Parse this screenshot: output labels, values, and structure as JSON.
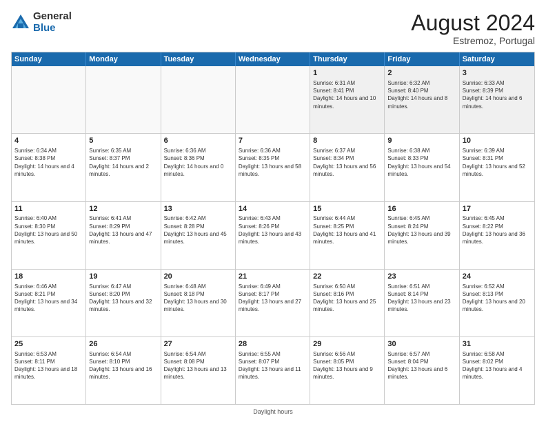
{
  "logo": {
    "general": "General",
    "blue": "Blue"
  },
  "title": {
    "month_year": "August 2024",
    "location": "Estremoz, Portugal"
  },
  "weekdays": [
    "Sunday",
    "Monday",
    "Tuesday",
    "Wednesday",
    "Thursday",
    "Friday",
    "Saturday"
  ],
  "footer": {
    "daylight_label": "Daylight hours"
  },
  "weeks": [
    [
      {
        "day": "",
        "info": ""
      },
      {
        "day": "",
        "info": ""
      },
      {
        "day": "",
        "info": ""
      },
      {
        "day": "",
        "info": ""
      },
      {
        "day": "1",
        "info": "Sunrise: 6:31 AM\nSunset: 8:41 PM\nDaylight: 14 hours and 10 minutes."
      },
      {
        "day": "2",
        "info": "Sunrise: 6:32 AM\nSunset: 8:40 PM\nDaylight: 14 hours and 8 minutes."
      },
      {
        "day": "3",
        "info": "Sunrise: 6:33 AM\nSunset: 8:39 PM\nDaylight: 14 hours and 6 minutes."
      }
    ],
    [
      {
        "day": "4",
        "info": "Sunrise: 6:34 AM\nSunset: 8:38 PM\nDaylight: 14 hours and 4 minutes."
      },
      {
        "day": "5",
        "info": "Sunrise: 6:35 AM\nSunset: 8:37 PM\nDaylight: 14 hours and 2 minutes."
      },
      {
        "day": "6",
        "info": "Sunrise: 6:36 AM\nSunset: 8:36 PM\nDaylight: 14 hours and 0 minutes."
      },
      {
        "day": "7",
        "info": "Sunrise: 6:36 AM\nSunset: 8:35 PM\nDaylight: 13 hours and 58 minutes."
      },
      {
        "day": "8",
        "info": "Sunrise: 6:37 AM\nSunset: 8:34 PM\nDaylight: 13 hours and 56 minutes."
      },
      {
        "day": "9",
        "info": "Sunrise: 6:38 AM\nSunset: 8:33 PM\nDaylight: 13 hours and 54 minutes."
      },
      {
        "day": "10",
        "info": "Sunrise: 6:39 AM\nSunset: 8:31 PM\nDaylight: 13 hours and 52 minutes."
      }
    ],
    [
      {
        "day": "11",
        "info": "Sunrise: 6:40 AM\nSunset: 8:30 PM\nDaylight: 13 hours and 50 minutes."
      },
      {
        "day": "12",
        "info": "Sunrise: 6:41 AM\nSunset: 8:29 PM\nDaylight: 13 hours and 47 minutes."
      },
      {
        "day": "13",
        "info": "Sunrise: 6:42 AM\nSunset: 8:28 PM\nDaylight: 13 hours and 45 minutes."
      },
      {
        "day": "14",
        "info": "Sunrise: 6:43 AM\nSunset: 8:26 PM\nDaylight: 13 hours and 43 minutes."
      },
      {
        "day": "15",
        "info": "Sunrise: 6:44 AM\nSunset: 8:25 PM\nDaylight: 13 hours and 41 minutes."
      },
      {
        "day": "16",
        "info": "Sunrise: 6:45 AM\nSunset: 8:24 PM\nDaylight: 13 hours and 39 minutes."
      },
      {
        "day": "17",
        "info": "Sunrise: 6:45 AM\nSunset: 8:22 PM\nDaylight: 13 hours and 36 minutes."
      }
    ],
    [
      {
        "day": "18",
        "info": "Sunrise: 6:46 AM\nSunset: 8:21 PM\nDaylight: 13 hours and 34 minutes."
      },
      {
        "day": "19",
        "info": "Sunrise: 6:47 AM\nSunset: 8:20 PM\nDaylight: 13 hours and 32 minutes."
      },
      {
        "day": "20",
        "info": "Sunrise: 6:48 AM\nSunset: 8:18 PM\nDaylight: 13 hours and 30 minutes."
      },
      {
        "day": "21",
        "info": "Sunrise: 6:49 AM\nSunset: 8:17 PM\nDaylight: 13 hours and 27 minutes."
      },
      {
        "day": "22",
        "info": "Sunrise: 6:50 AM\nSunset: 8:16 PM\nDaylight: 13 hours and 25 minutes."
      },
      {
        "day": "23",
        "info": "Sunrise: 6:51 AM\nSunset: 8:14 PM\nDaylight: 13 hours and 23 minutes."
      },
      {
        "day": "24",
        "info": "Sunrise: 6:52 AM\nSunset: 8:13 PM\nDaylight: 13 hours and 20 minutes."
      }
    ],
    [
      {
        "day": "25",
        "info": "Sunrise: 6:53 AM\nSunset: 8:11 PM\nDaylight: 13 hours and 18 minutes."
      },
      {
        "day": "26",
        "info": "Sunrise: 6:54 AM\nSunset: 8:10 PM\nDaylight: 13 hours and 16 minutes."
      },
      {
        "day": "27",
        "info": "Sunrise: 6:54 AM\nSunset: 8:08 PM\nDaylight: 13 hours and 13 minutes."
      },
      {
        "day": "28",
        "info": "Sunrise: 6:55 AM\nSunset: 8:07 PM\nDaylight: 13 hours and 11 minutes."
      },
      {
        "day": "29",
        "info": "Sunrise: 6:56 AM\nSunset: 8:05 PM\nDaylight: 13 hours and 9 minutes."
      },
      {
        "day": "30",
        "info": "Sunrise: 6:57 AM\nSunset: 8:04 PM\nDaylight: 13 hours and 6 minutes."
      },
      {
        "day": "31",
        "info": "Sunrise: 6:58 AM\nSunset: 8:02 PM\nDaylight: 13 hours and 4 minutes."
      }
    ]
  ]
}
